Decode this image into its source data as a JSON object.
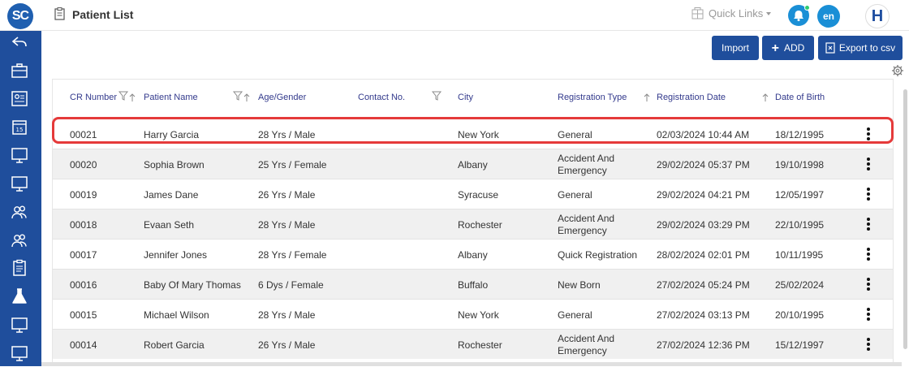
{
  "app": {
    "logo_text": "SC",
    "page_title": "Patient List",
    "language": "en",
    "hospital_logo": "H"
  },
  "header": {
    "quick_links_label": "Quick Links"
  },
  "toolbar": {
    "import_label": "Import",
    "add_label": "ADD",
    "export_label": "Export to csv"
  },
  "sidebar": {
    "icons": [
      "back-arrow-icon",
      "briefcase-icon",
      "id-card-icon",
      "calendar-icon",
      "monitor-icon",
      "monitor-icon",
      "users-icon",
      "users-icon",
      "clipboard-icon",
      "flask-icon",
      "monitor-icon",
      "monitor-icon"
    ]
  },
  "table": {
    "columns": [
      "CR Number",
      "Patient Name",
      "Age/Gender",
      "Contact No.",
      "City",
      "Registration Type",
      "Registration Date",
      "Date of Birth"
    ],
    "rows": [
      {
        "cr": "00021",
        "name": "Harry Garcia",
        "age_gender": "28 Yrs / Male",
        "contact": "",
        "city": "New York",
        "reg_type": "General",
        "reg_date": "02/03/2024 10:44 AM",
        "dob": "18/12/1995"
      },
      {
        "cr": "00020",
        "name": "Sophia Brown",
        "age_gender": "25 Yrs / Female",
        "contact": "",
        "city": "Albany",
        "reg_type": "Accident And Emergency",
        "reg_date": "29/02/2024 05:37 PM",
        "dob": "19/10/1998"
      },
      {
        "cr": "00019",
        "name": "James Dane",
        "age_gender": "26 Yrs / Male",
        "contact": "",
        "city": "Syracuse",
        "reg_type": "General",
        "reg_date": "29/02/2024 04:21 PM",
        "dob": "12/05/1997"
      },
      {
        "cr": "00018",
        "name": "Evaan Seth",
        "age_gender": "28 Yrs / Male",
        "contact": "",
        "city": "Rochester",
        "reg_type": "Accident And Emergency",
        "reg_date": "29/02/2024 03:29 PM",
        "dob": "22/10/1995"
      },
      {
        "cr": "00017",
        "name": "Jennifer Jones",
        "age_gender": "28 Yrs / Female",
        "contact": "",
        "city": "Albany",
        "reg_type": "Quick Registration",
        "reg_date": "28/02/2024 02:01 PM",
        "dob": "10/11/1995"
      },
      {
        "cr": "00016",
        "name": "Baby Of Mary Thomas",
        "age_gender": "6 Dys / Female",
        "contact": "",
        "city": "Buffalo",
        "reg_type": "New Born",
        "reg_date": "27/02/2024 05:24 PM",
        "dob": "25/02/2024"
      },
      {
        "cr": "00015",
        "name": "Michael Wilson",
        "age_gender": "28 Yrs / Male",
        "contact": "",
        "city": "New York",
        "reg_type": "General",
        "reg_date": "27/02/2024 03:13 PM",
        "dob": "20/10/1995"
      },
      {
        "cr": "00014",
        "name": "Robert Garcia",
        "age_gender": "26 Yrs / Male",
        "contact": "",
        "city": "Rochester",
        "reg_type": "Accident And Emergency",
        "reg_date": "27/02/2024 12:36 PM",
        "dob": "15/12/1997"
      }
    ]
  },
  "colors": {
    "primary": "#1f4e9c",
    "accent": "#1a8fd6",
    "highlight": "#e53a3a",
    "header_text": "#333a8c"
  }
}
